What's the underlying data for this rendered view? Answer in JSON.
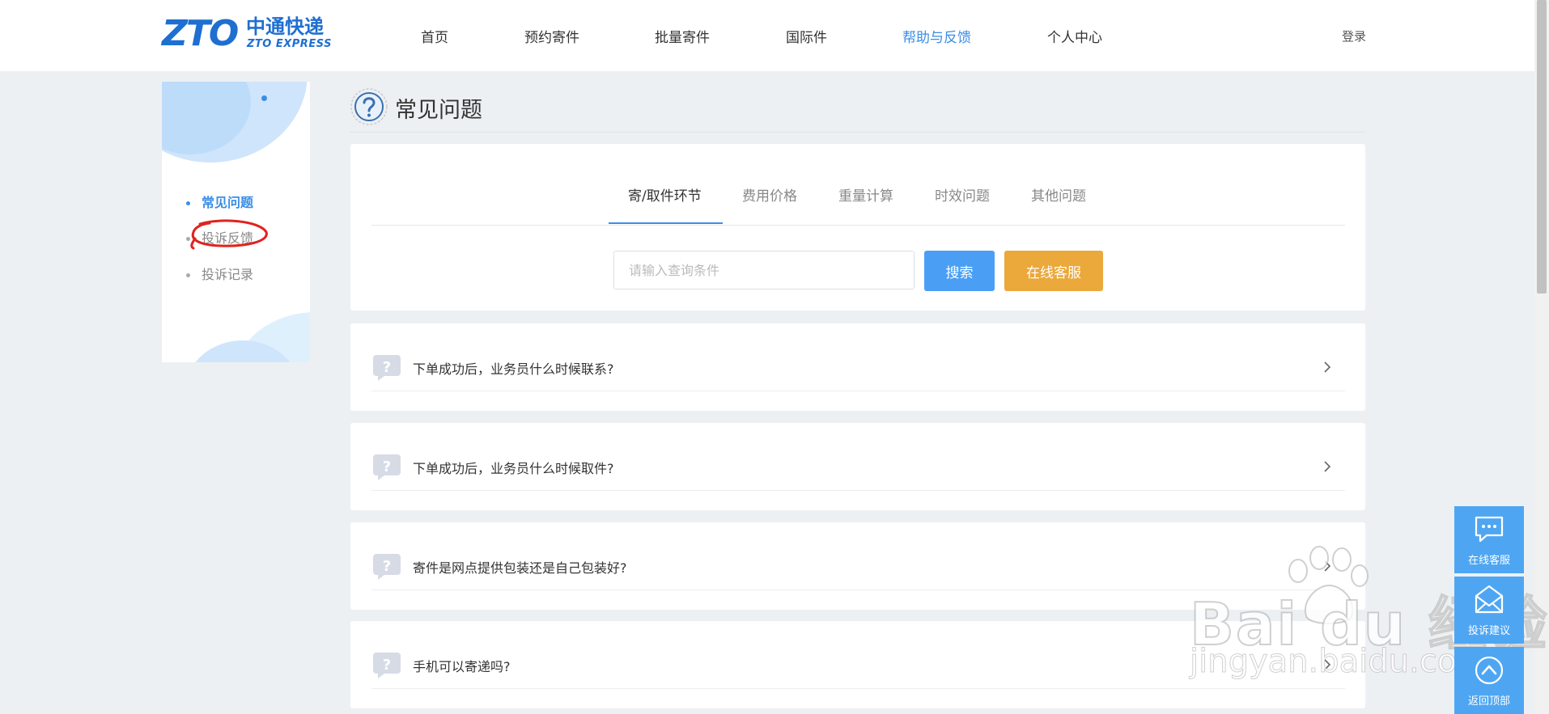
{
  "brand": {
    "logo_mark": "ZTO",
    "logo_cn": "中通快递",
    "logo_en": "ZTO EXPRESS",
    "color": "#1e6fd0"
  },
  "nav": {
    "items": [
      {
        "label": "首页"
      },
      {
        "label": "预约寄件"
      },
      {
        "label": "批量寄件"
      },
      {
        "label": "国际件"
      },
      {
        "label": "帮助与反馈",
        "active": true
      },
      {
        "label": "个人中心"
      }
    ],
    "login_label": "登录",
    "accent": "#3a8ee6"
  },
  "sidebar": {
    "items": [
      {
        "label": "常见问题",
        "active": true
      },
      {
        "label": "投诉反馈"
      },
      {
        "label": "投诉记录"
      }
    ]
  },
  "page": {
    "title": "常见问题"
  },
  "tabs": [
    {
      "label": "寄/取件环节",
      "active": true
    },
    {
      "label": "费用价格"
    },
    {
      "label": "重量计算"
    },
    {
      "label": "时效问题"
    },
    {
      "label": "其他问题"
    }
  ],
  "search": {
    "placeholder": "请输入查询条件",
    "value": "",
    "search_label": "搜索",
    "service_label": "在线客服",
    "search_color": "#4a9ff5",
    "service_color": "#eba83b"
  },
  "faqs": [
    {
      "question": "下单成功后，业务员什么时候联系?"
    },
    {
      "question": "下单成功后，业务员什么时候取件?"
    },
    {
      "question": "寄件是网点提供包装还是自己包装好?"
    },
    {
      "question": "手机可以寄递吗?"
    }
  ],
  "float_panel": [
    {
      "label": "在线客服",
      "icon": "chat-icon"
    },
    {
      "label": "投诉建议",
      "icon": "mail-icon"
    },
    {
      "label": "返回顶部",
      "icon": "arrow-up-icon"
    }
  ],
  "watermark": {
    "main": "Bai du 经验",
    "sub": "jingyan.baidu.com"
  }
}
